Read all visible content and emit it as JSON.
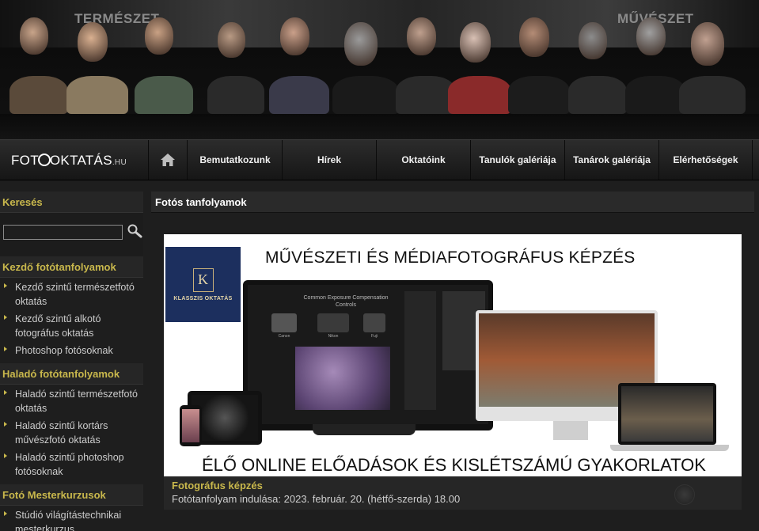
{
  "banner": {
    "label_left": "TERMÉSZET",
    "label_right": "MŰVÉSZET"
  },
  "nav": {
    "logo_main": "FOT",
    "logo_mid": "OKTATÁS",
    "logo_suffix": ".HU",
    "home_icon": "home-icon",
    "items": [
      "Bemutatkozunk",
      "Hírek",
      "Oktatóink",
      "Tanulók galériája",
      "Tanárok galériája",
      "Elérhetőségek"
    ]
  },
  "sidebar": {
    "search_title": "Keresés",
    "search_value": "",
    "search_icon": "magnifier-icon",
    "sections": [
      {
        "title": "Kezdő fotótanfolyamok",
        "items": [
          "Kezdő szintű természetfotó oktatás",
          "Kezdő szintű alkotó fotográfus oktatás",
          "Photoshop fotósoknak"
        ]
      },
      {
        "title": "Haladó fotótanfolyamok",
        "items": [
          "Haladó szintű természetfotó oktatás",
          "Haladó szintű kortárs művészfotó oktatás",
          "Haladó szintű photoshop fotósoknak"
        ]
      },
      {
        "title": "Fotó Mesterkurzusok",
        "items": [
          "Stúdió világítástechnikai mesterkurzus"
        ]
      }
    ]
  },
  "main": {
    "title": "Fotós tanfolyamok",
    "promo": {
      "headline": "MŰVÉSZETI ÉS MÉDIAFOTOGRÁFUS KÉPZÉS",
      "footer": "ÉLŐ ONLINE ELŐADÁSOK ÉS KISLÉTSZÁMÚ GYAKORLATOK",
      "brand_letter": "K",
      "brand_name": "KLASSZIS OKTATÁS",
      "slide_heading": "Common Exposure Compensation Controls",
      "slide_labels": [
        "Canon",
        "Nikon",
        "Fuji"
      ]
    },
    "caption": {
      "title": "Fotográfus képzés",
      "text": "Fotótanfolyam indulása: 2023. február. 20. (hétfő-szerda) 18.00"
    }
  },
  "colors": {
    "accent": "#c9b84c",
    "background": "#1e1e1e",
    "brand_navy": "#1c2f5e"
  }
}
